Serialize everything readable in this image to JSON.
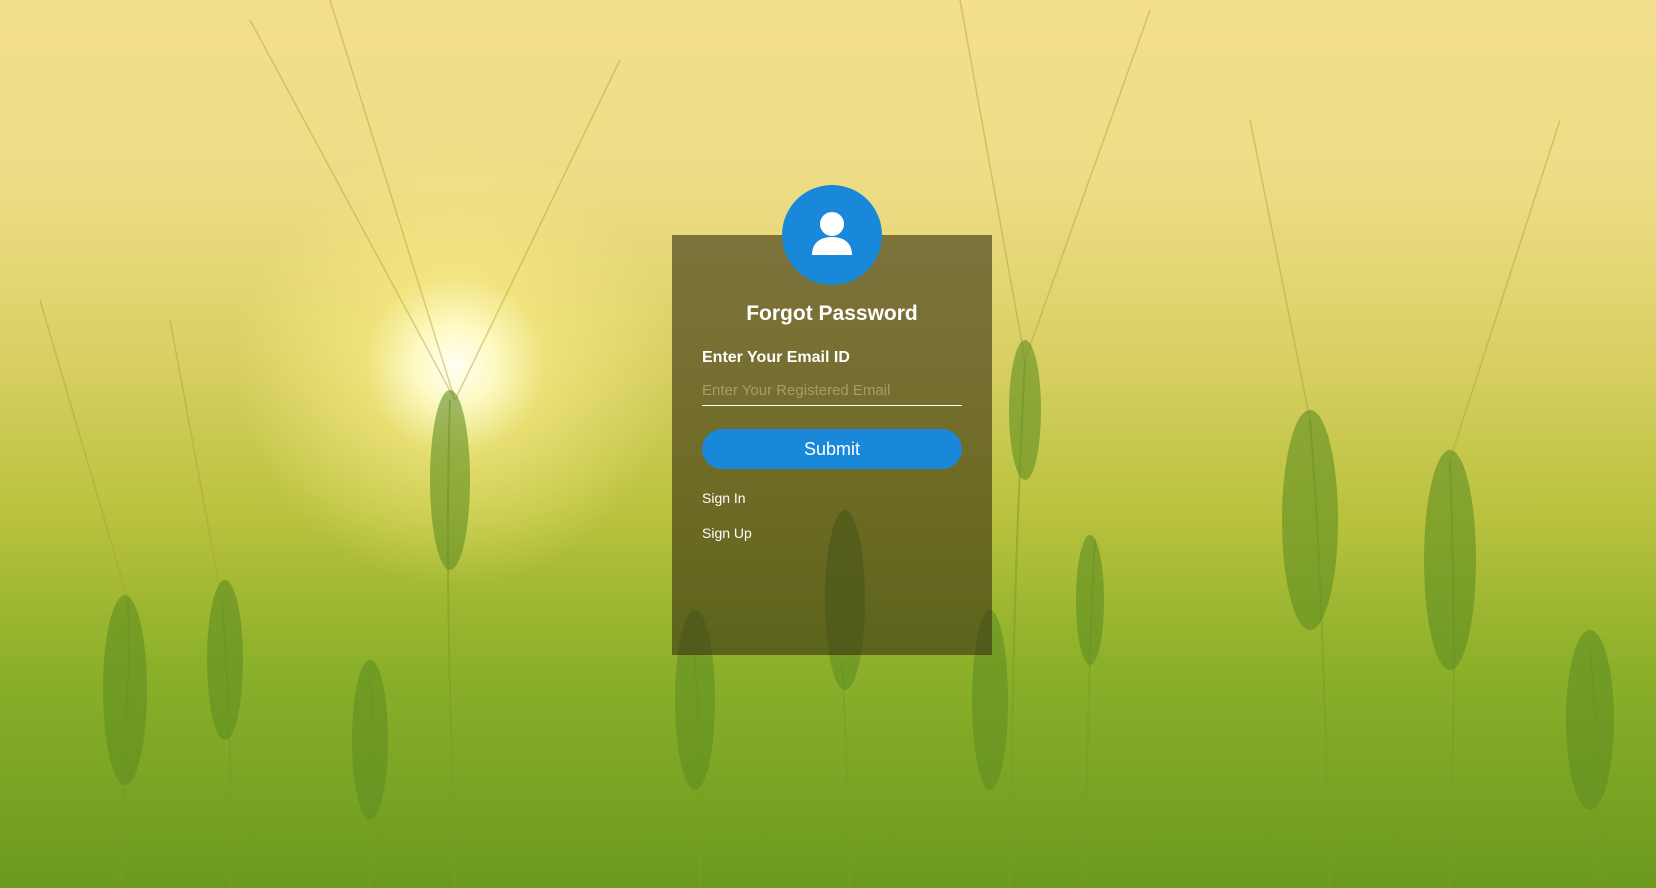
{
  "page": {
    "title": "Forgot Password"
  },
  "form": {
    "heading": "Forgot Password",
    "email_label": "Enter Your Email ID",
    "email_placeholder": "Enter Your Registered Email",
    "email_value": "",
    "submit_label": "Submit"
  },
  "links": {
    "sign_in": "Sign In",
    "sign_up": "Sign Up"
  },
  "icons": {
    "avatar": "user-icon"
  },
  "colors": {
    "accent": "#1a88d8",
    "card_overlay": "rgba(60,52,20,0.62)",
    "text": "#ffffff"
  }
}
